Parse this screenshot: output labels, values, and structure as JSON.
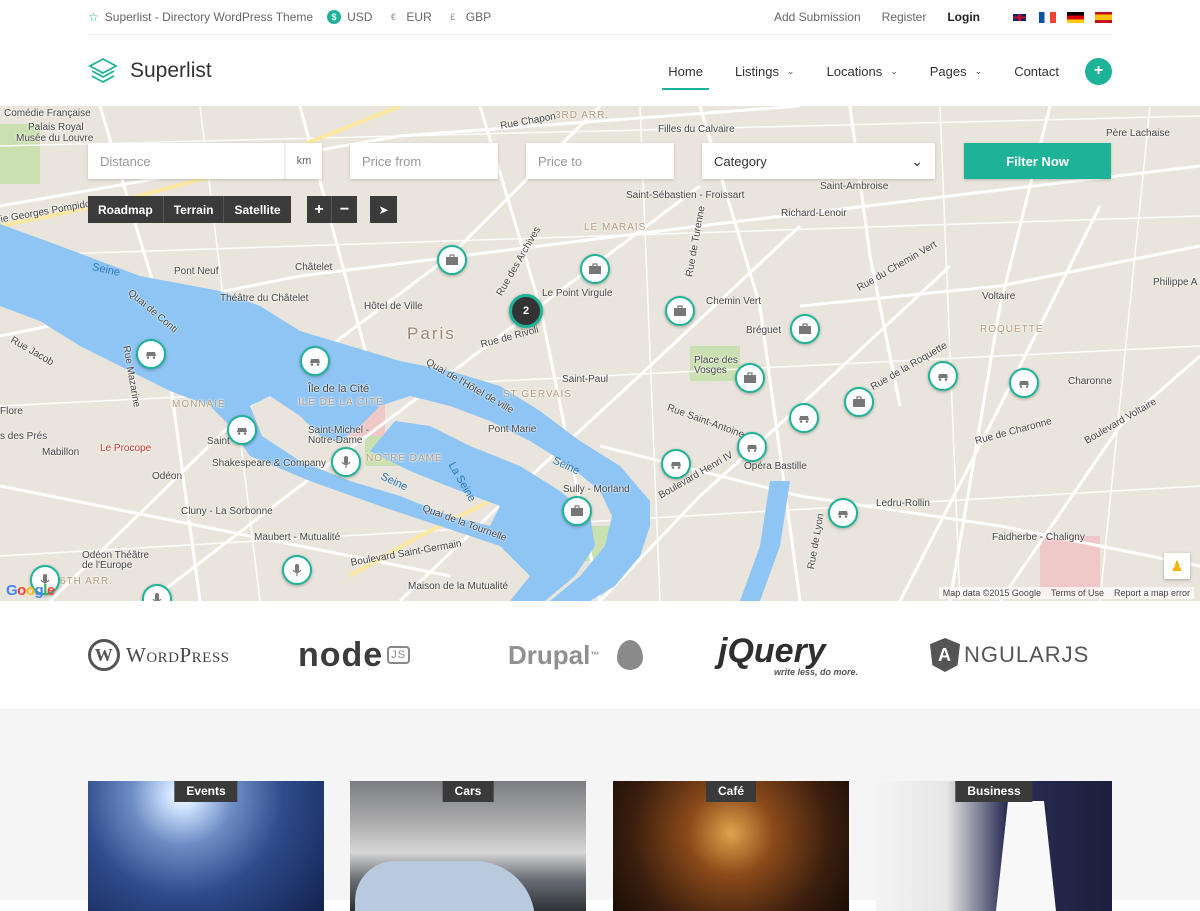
{
  "topbar": {
    "site_title": "Superlist - Directory WordPress Theme",
    "currencies": [
      {
        "code": "USD",
        "symbol": "$"
      },
      {
        "code": "EUR",
        "symbol": "€"
      },
      {
        "code": "GBP",
        "symbol": "£"
      }
    ],
    "links": {
      "add_submission": "Add Submission",
      "register": "Register",
      "login": "Login"
    },
    "languages": [
      "uk-flag-icon",
      "fr-flag-icon",
      "de-flag-icon",
      "es-flag-icon"
    ]
  },
  "header": {
    "brand": "Superlist",
    "nav": [
      {
        "label": "Home",
        "active": true
      },
      {
        "label": "Listings",
        "dropdown": true
      },
      {
        "label": "Locations",
        "dropdown": true
      },
      {
        "label": "Pages",
        "dropdown": true
      },
      {
        "label": "Contact"
      }
    ],
    "add_label": "+"
  },
  "filter": {
    "distance_placeholder": "Distance",
    "distance_unit": "km",
    "price_from_placeholder": "Price from",
    "price_to_placeholder": "Price to",
    "category_selected": "Category",
    "submit_label": "Filter Now"
  },
  "map": {
    "type_buttons": [
      "Roadmap",
      "Terrain",
      "Satellite"
    ],
    "zoom_in": "+",
    "zoom_out": "−",
    "cluster_count": "2",
    "labels": {
      "comedie": "Comédie Française",
      "palais": "Palais Royal",
      "musee": "Musée du Louvre",
      "pompidou": "ie Georges Pompidou",
      "seine1": "Seine",
      "pontneuf": "Pont Neuf",
      "chatelet": "Châtelet",
      "theatre": "Théâtre du Châtelet",
      "hotelville": "Hôtel de Ville",
      "paris": "Paris",
      "lepointvirgule": "Le Point Virgule",
      "marais": "LE MARAIS",
      "arr3": "3RD ARR.",
      "filles": "Filles du Calvaire",
      "stsebastien": "Saint-Sébastien - Froissart",
      "stambroise": "Saint-Ambroise",
      "richard": "Richard-Lenoir",
      "chemin": "Chemin Vert",
      "breguet": "Bréguet",
      "voltaire": "Voltaire",
      "roquette": "ROQUETTE",
      "placevosges": "Place des Vosges",
      "stpaul": "Saint-Paul",
      "stgervais": "ST GERVAIS",
      "iledelacite": "Île de la Cité",
      "iledelacite2": "ILE DE LA CITÉ",
      "monnaie": "MONNAIE",
      "notredame": "NOTRE DAME",
      "stmichel": "Saint-Michel - Notre-Dame",
      "shakespeare": "Shakespeare & Company",
      "pontmarie": "Pont Marie",
      "sully": "Sully - Morland",
      "bastille": "Opéra Bastille",
      "ledru": "Ledru-Rollin",
      "faidherbe": "Faidherbe - Chaligny",
      "charonne": "Charonne",
      "perelachaise": "Père Lachaise",
      "philippe": "Philippe A",
      "cluny": "Cluny - La Sorbonne",
      "maubert": "Maubert - Mutualité",
      "odeon": "Odéon",
      "odeontheatre": "Odéon Théâtre de l'Europe",
      "maison": "Maison de la Mutualité",
      "leprocope": "Le Procope",
      "mabillon": "Mabillon",
      "arr6": "6TH ARR.",
      "seine2": "Seine",
      "seine3": "Seine",
      "laseine": "La Seine",
      "saint": "Saint",
      "quaiconti": "Quai de Conti",
      "quaihotel": "Quai de l'Hôtel de ville",
      "quaitournelle": "Quai de la Tournelle",
      "boulstgermain": "Boulevard Saint-Germain",
      "boulhenri": "Boulevard Henri IV",
      "ruerivoli": "Rue de Rivoli",
      "ruestantoine": "Rue Saint-Antoine",
      "ruecharonne": "Rue de Charonne",
      "rueroquette": "Rue de la Roquette",
      "boulvoltaire": "Boulevard Voltaire",
      "ruechemin": "Rue du Chemin Vert",
      "rueturenne": "Rue de Turenne",
      "ruelyon": "Rue de Lyon",
      "ruejacob": "Rue Jacob",
      "ruemazarine": "Rue Mazarine",
      "ruedesprés": "s des Prés",
      "flore": "Flore",
      "ruedesarchives": "Rue des Archives",
      "rueduchapon": "Rue Chapon"
    },
    "footer": {
      "copyright": "Map data ©2015 Google",
      "terms": "Terms of Use",
      "report": "Report a map error"
    },
    "google_letters": [
      "G",
      "o",
      "o",
      "g",
      "l",
      "e"
    ]
  },
  "partners": {
    "wordpress": "WordPress",
    "node": "node",
    "node_js": "JS",
    "drupal": "Drupal",
    "drupal_tm": "™",
    "jquery": "jQuery",
    "jquery_tagline": "write less, do more.",
    "angular_letter": "A",
    "angular": "NGULARJS"
  },
  "categories": [
    {
      "label": "Events"
    },
    {
      "label": "Cars"
    },
    {
      "label": "Café"
    },
    {
      "label": "Business"
    }
  ],
  "colors": {
    "accent": "#1eb398",
    "dark": "#3a3a3a",
    "water": "#8ec5f4"
  }
}
